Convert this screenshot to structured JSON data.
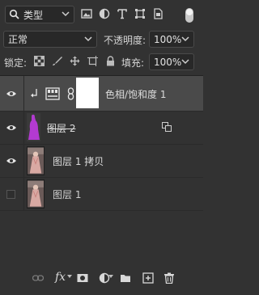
{
  "filter": {
    "label": "类型"
  },
  "blend_mode": {
    "value": "正常"
  },
  "opacity": {
    "label": "不透明度:",
    "value": "100%"
  },
  "lock": {
    "label": "锁定:"
  },
  "fill": {
    "label": "填充:",
    "value": "100%"
  },
  "layers": [
    {
      "name": "色相/饱和度 1",
      "visible": true,
      "selected": true,
      "type": "adjustment"
    },
    {
      "name": "图层 2",
      "visible": true,
      "selected": false,
      "type": "pixel",
      "color": "#b33ad1"
    },
    {
      "name": "图层 1 拷贝",
      "visible": true,
      "selected": false,
      "type": "pixel"
    },
    {
      "name": "图层 1",
      "visible": false,
      "selected": false,
      "type": "pixel"
    }
  ],
  "icons": [
    "search-icon",
    "image-filter-icon",
    "adjustment-filter-icon",
    "type-filter-icon",
    "shape-filter-icon",
    "smartobject-filter-icon",
    "link-layers-icon",
    "fx-icon",
    "add-mask-icon",
    "new-adjustment-icon",
    "new-group-icon",
    "new-layer-icon",
    "delete-icon"
  ],
  "colors": {
    "panel": "#323232",
    "selected_row": "#4a4a4a",
    "layer2_fill": "#b33ad1"
  }
}
